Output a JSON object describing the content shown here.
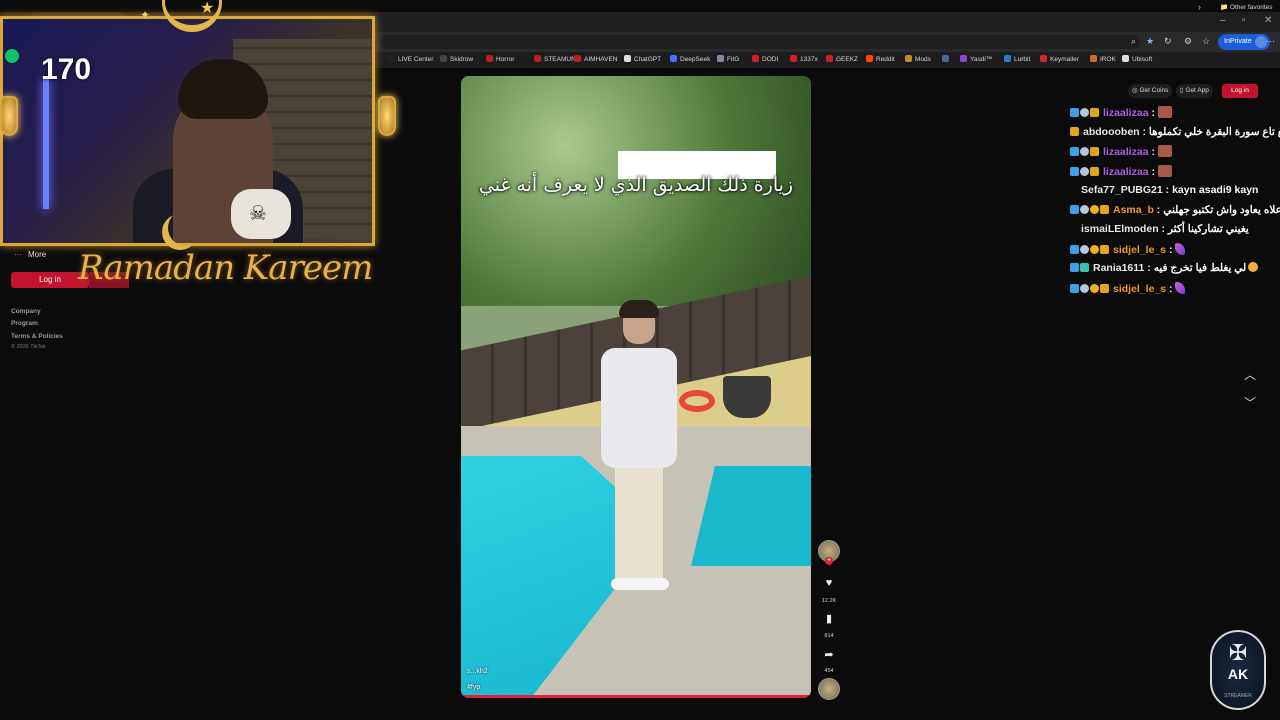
{
  "browser": {
    "tab_title": "",
    "inprivate_label": "InPrivate",
    "favorites": [
      {
        "label": "LIVE Center",
        "color": "#222222"
      },
      {
        "label": "Skidrow",
        "color": "#444444"
      },
      {
        "label": "Horror",
        "color": "#b82020"
      },
      {
        "label": "STEAMUN",
        "color": "#b82020"
      },
      {
        "label": "AIMHAVEN",
        "color": "#b82020"
      },
      {
        "label": "ChatGPT",
        "color": "#dddddd"
      },
      {
        "label": "DeepSeek",
        "color": "#4d6bfe"
      },
      {
        "label": "FitG",
        "color": "#8888aa"
      },
      {
        "label": "DODI",
        "color": "#d22020"
      },
      {
        "label": "1337x",
        "color": "#d22020"
      },
      {
        "label": "GEEKZ",
        "color": "#d22020"
      },
      {
        "label": "Reddit",
        "color": "#ff4500"
      },
      {
        "label": "Mods",
        "color": "#c08a2a"
      },
      {
        "label": "",
        "color": "#4a6a9a"
      },
      {
        "label": "Yasdi™",
        "color": "#8a4ad0"
      },
      {
        "label": "Lurbit",
        "color": "#2a7ad0"
      },
      {
        "label": "Keymailer",
        "color": "#d02a2a"
      },
      {
        "label": "IROK",
        "color": "#d06a2a"
      },
      {
        "label": "Ubisoft",
        "color": "#dddddd"
      }
    ],
    "other_favorites": "Other favorites"
  },
  "overlay": {
    "viewer_count": "170",
    "banner_text": "Ramadan Kareem"
  },
  "tiktok": {
    "nav": {
      "more_label": "More",
      "login_label": "Log in",
      "footer_links": [
        "Company",
        "Program",
        "Terms & Policies"
      ],
      "copyright": "© 2026 TikTok"
    },
    "header_buttons": {
      "get_coins": "Get Coins",
      "get_app": "Get App",
      "login": "Log in"
    },
    "video": {
      "caption": "زيارة ذلك الصديق الذي لا يعرف أنه غني",
      "username": "s...kh2",
      "hashtag": "#fyp",
      "progress": 1.0
    },
    "actions": {
      "likes": "12.2K",
      "saves": "814",
      "shares": "454"
    }
  },
  "chat": [
    {
      "badges": [
        "blue",
        "star",
        "gold"
      ],
      "name": "lizaalizaa",
      "name_color": "purple",
      "message": "",
      "emote": "portrait"
    },
    {
      "badges": [
        "gold"
      ],
      "name": "abdoooben",
      "name_color": "white",
      "message": "رجع تاع سورة البقرة خلي تكملوها",
      "emote": ""
    },
    {
      "badges": [
        "blue",
        "star",
        "gold"
      ],
      "name": "lizaalizaa",
      "name_color": "purple",
      "message": "",
      "emote": "portrait"
    },
    {
      "badges": [
        "blue",
        "star",
        "gold"
      ],
      "name": "lizaalizaa",
      "name_color": "purple",
      "message": "",
      "emote": "portrait"
    },
    {
      "badges": [],
      "name": "Sefa77_PUBG21",
      "name_color": "white",
      "message": "kayn asadi9 kayn",
      "emote": ""
    },
    {
      "badges": [
        "blue",
        "star",
        "coin",
        "gold"
      ],
      "name": "Asma_b",
      "name_color": "orange",
      "message": "هو علاه يعاود واش تكتبو جهلني",
      "emote": ""
    },
    {
      "badges": [],
      "name": "ismaiLElmoden",
      "name_color": "white",
      "message": "يغيني تشاركينا أكثر",
      "emote": ""
    },
    {
      "badges": [
        "blue",
        "star",
        "coin",
        "gold"
      ],
      "name": "sidjel_le_s",
      "name_color": "orange",
      "message": "",
      "emote": "feather"
    },
    {
      "badges": [
        "blue",
        "teal"
      ],
      "name": "Rania1611",
      "name_color": "white",
      "message": "لي يغلط فيا تخرج فيه",
      "emote": "laugh"
    },
    {
      "badges": [
        "blue",
        "star",
        "coin",
        "gold"
      ],
      "name": "sidjel_le_s",
      "name_color": "orange",
      "message": "",
      "emote": "feather"
    }
  ],
  "logo": {
    "text": "AK",
    "sub": "STREAMER"
  }
}
